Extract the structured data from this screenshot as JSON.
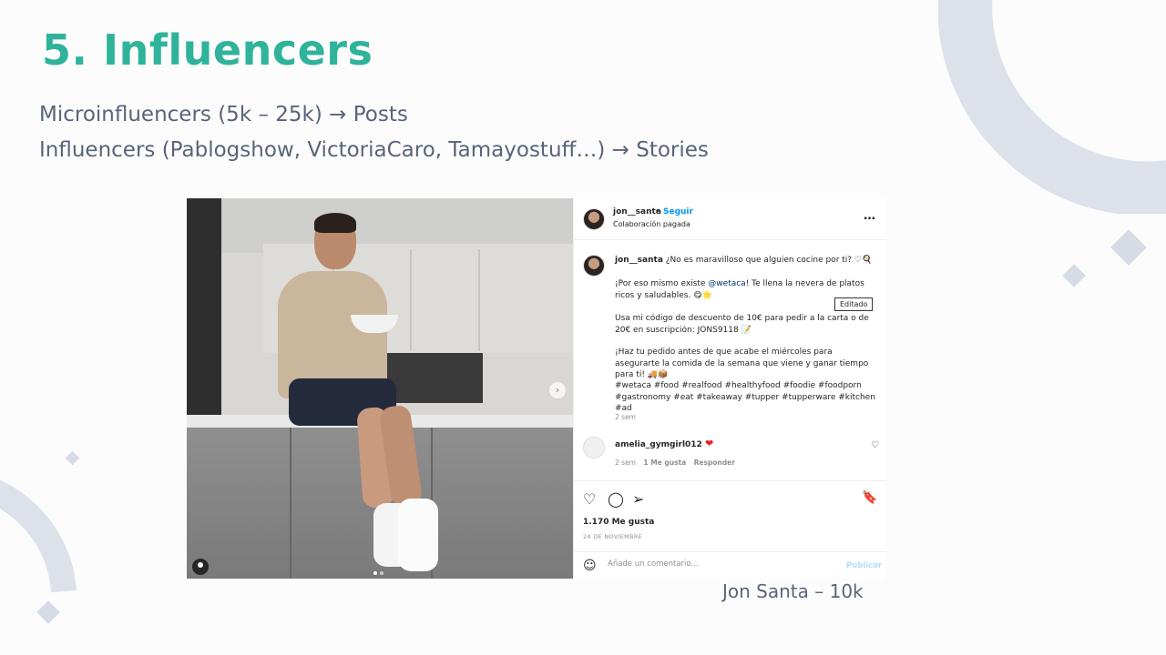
{
  "slide": {
    "title": "5. Influencers",
    "line1": "Microinfluencers (5k – 25k) → Posts",
    "line2": "Influencers (Pablogshow, VictoriaCaro, Tamayostuff…) → Stories",
    "caption": "Jon Santa – 10k"
  },
  "colors": {
    "title": "#2fb39a",
    "body_text": "#5a6478",
    "decor": "#d6dbe5",
    "link": "#0095f6",
    "hashtag": "#00376b"
  },
  "post": {
    "header": {
      "username": "jon__santa",
      "separator": "•",
      "follow_label": "Seguir",
      "subtitle": "Colaboración pagada",
      "more_icon": "…"
    },
    "caption": {
      "username": "jon__santa",
      "p1": "¿No es maravilloso que alguien cocine por ti? ♡🍳",
      "p2_pre": "¡Por eso mismo existe ",
      "p2_mention": "@wetaca",
      "p2_post": "! Te llena la nevera de platos ricos y saludables. 😋🌟",
      "p3": "Usa mi código de descuento de 10€ para pedir a la carta o de 20€ en suscripción: JONS9118 📝",
      "p4": "¡Haz tu pedido antes de que acabe el miércoles para asegurarte la comida de la semana que viene y ganar tiempo para ti! 🚚📦",
      "hashtags": "#wetaca #food #realfood #healthyfood #foodie #foodporn #gastronomy #eat #takeaway #tupper #tupperware #kitchen #ad",
      "time": "2 sem",
      "edited_tooltip": "Editado"
    },
    "comment": {
      "username": "amelia_gymgirl012",
      "emoji": "❤",
      "time": "2 sem",
      "likes": "1 Me gusta",
      "reply": "Responder"
    },
    "actions": {
      "like_icon": "♡",
      "comment_icon": "◯",
      "share_icon": "➢",
      "save_icon": "🔖"
    },
    "likes": "1.170 Me gusta",
    "date": "24 DE NOVIEMBRE",
    "compose": {
      "emoji_icon": "☺",
      "placeholder": "Añade un comentario...",
      "publish": "Publicar"
    },
    "photo": {
      "next_icon": "›"
    }
  }
}
